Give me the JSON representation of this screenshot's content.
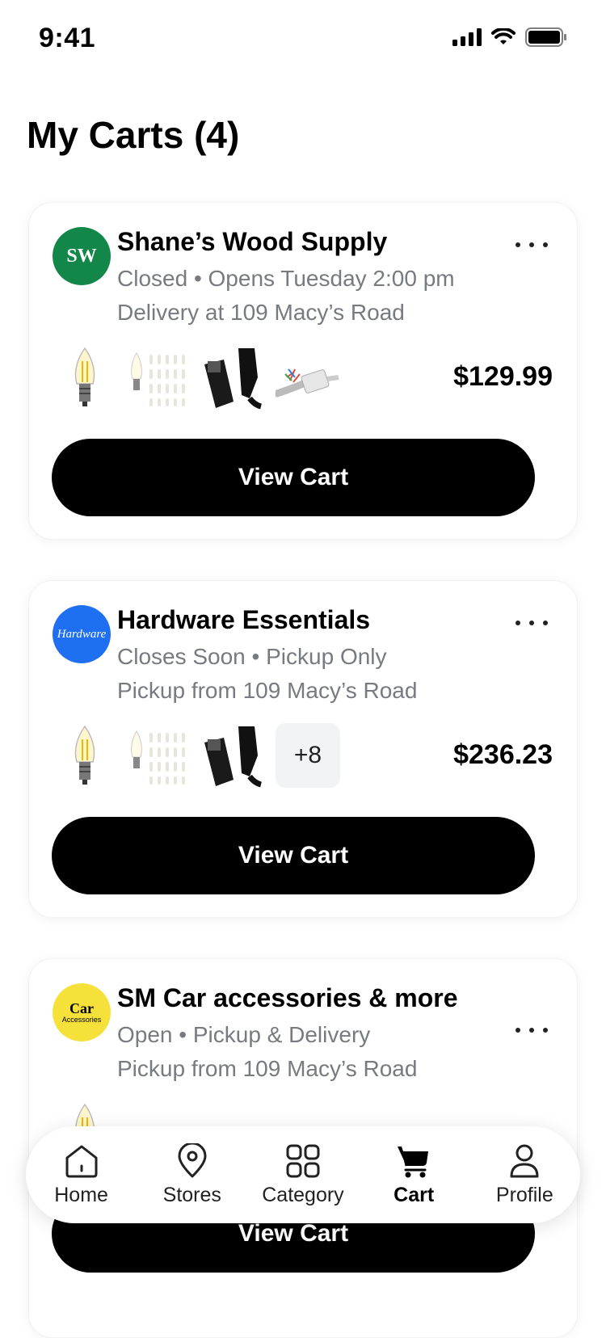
{
  "status_bar": {
    "time": "9:41"
  },
  "page": {
    "title": "My Carts (4)"
  },
  "carts": [
    {
      "logo_text": "SW",
      "logo_color": "#13864a",
      "name": "Shane’s Wood Supply",
      "status": "Closed • Opens Tuesday 2:00 pm",
      "address": "Delivery at 109 Macy’s Road",
      "price": "$129.99",
      "button": "View Cart",
      "items": [
        "bulb-icon",
        "bulb-pack-icon",
        "cable-icon",
        "ethernet-cable-icon"
      ]
    },
    {
      "logo_text": "Hardware",
      "logo_color": "#1f6ff2",
      "name": "Hardware Essentials",
      "status": "Closes Soon • Pickup Only",
      "address": "Pickup from 109 Macy’s Road",
      "price": "$236.23",
      "button": "View Cart",
      "items": [
        "bulb-icon",
        "bulb-pack-icon",
        "cable-icon"
      ],
      "more_count": "+8"
    },
    {
      "logo_text_line1": "Car",
      "logo_text_line2": "Accessories",
      "logo_color": "#f5e13a",
      "name": "SM Car accessories & more",
      "status": "Open • Pickup & Delivery",
      "address": "Pickup from 109 Macy’s Road",
      "button": "View Cart"
    }
  ],
  "tab_bar": {
    "items": [
      {
        "label": "Home",
        "icon": "home-icon"
      },
      {
        "label": "Stores",
        "icon": "location-pin-icon"
      },
      {
        "label": "Category",
        "icon": "grid-icon"
      },
      {
        "label": "Cart",
        "icon": "cart-icon",
        "active": true
      },
      {
        "label": "Profile",
        "icon": "person-icon"
      }
    ]
  }
}
